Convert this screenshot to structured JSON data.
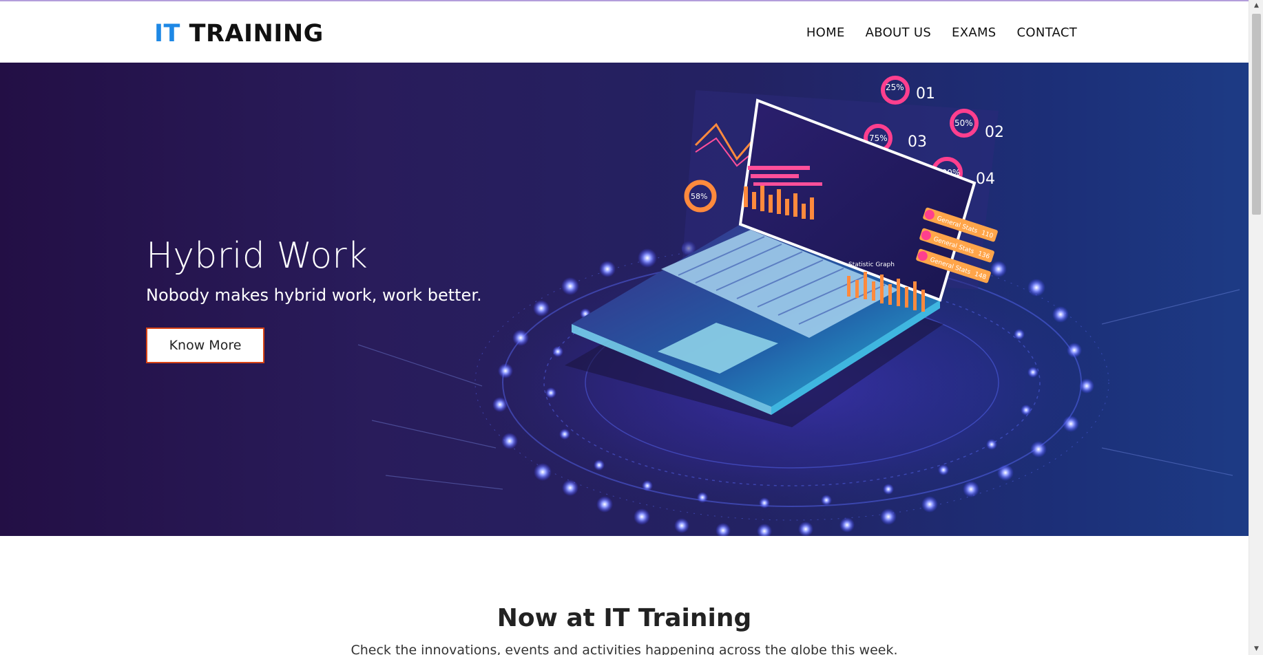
{
  "header": {
    "logo": {
      "part1": "IT",
      "part2": "TRAINING"
    },
    "nav": [
      {
        "label": "HOME"
      },
      {
        "label": "ABOUT US"
      },
      {
        "label": "EXAMS"
      },
      {
        "label": "CONTACT"
      }
    ]
  },
  "hero": {
    "title": "Hybrid Work",
    "subtitle": "Nobody makes hybrid work, work better.",
    "button_label": "Know More",
    "illustration": {
      "donut_labels": [
        "25%",
        "50%",
        "75%",
        "100%",
        "58%"
      ],
      "panel_numbers": [
        "01",
        "02",
        "03",
        "04"
      ],
      "graph_caption": "Statistic Graph",
      "stat_tags": [
        {
          "label": "General Stats",
          "value": "110"
        },
        {
          "label": "General Stats",
          "value": "136"
        },
        {
          "label": "General Stats",
          "value": "148"
        }
      ]
    }
  },
  "section": {
    "title": "Now at IT Training",
    "subtitle": "Check the innovations, events and activities happening across the globe this week."
  },
  "colors": {
    "logo_accent": "#1e88e5",
    "button_border": "#d84315",
    "hero_dark": "#230f45",
    "hero_blue": "#1d3b85",
    "glow": "#4d5bff"
  },
  "icons": {
    "scroll_up": "triangle-up",
    "scroll_down": "triangle-down"
  }
}
